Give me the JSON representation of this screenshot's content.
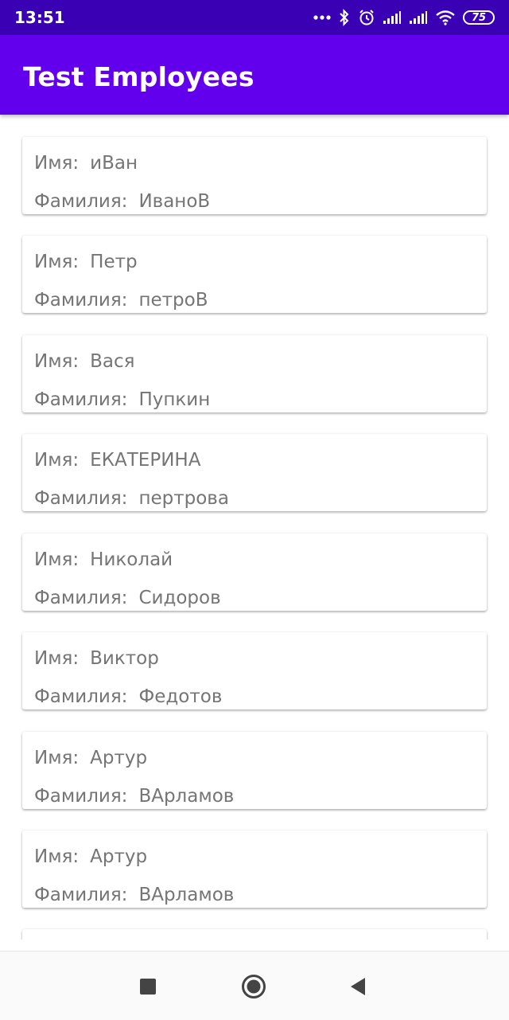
{
  "status_bar": {
    "time": "13:51",
    "battery": "75",
    "icons": [
      "more-dots-icon",
      "bluetooth-icon",
      "alarm-icon",
      "signal-icon",
      "signal-icon",
      "wifi-icon",
      "battery-icon"
    ]
  },
  "app_bar": {
    "title": "Test Employees",
    "color": "#6200ee"
  },
  "labels": {
    "first_name": "Имя:",
    "last_name": "Фамилия:"
  },
  "employees": [
    {
      "first": "иВан",
      "last": "ИваноВ"
    },
    {
      "first": "Петр",
      "last": "петроВ"
    },
    {
      "first": "Вася",
      "last": "Пупкин"
    },
    {
      "first": "ЕКАТЕРИНА",
      "last": "пертрова"
    },
    {
      "first": "Николай",
      "last": "Сидоров"
    },
    {
      "first": "Виктор",
      "last": "Федотов"
    },
    {
      "first": "Артур",
      "last": "ВАрламов"
    },
    {
      "first": "Артур",
      "last": "ВАрламов"
    }
  ],
  "nav_bar": {
    "icons": [
      "recents-square-icon",
      "home-circle-icon",
      "back-triangle-icon"
    ]
  }
}
